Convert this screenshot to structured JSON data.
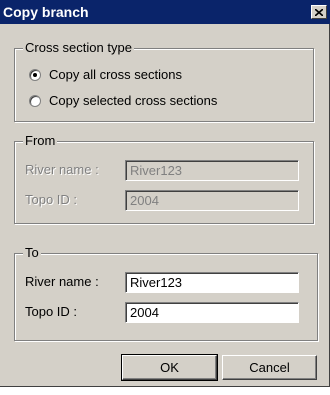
{
  "window": {
    "title": "Copy branch"
  },
  "cross_section": {
    "legend": "Cross section type",
    "options": [
      {
        "label": "Copy all cross sections",
        "selected": true
      },
      {
        "label": "Copy selected cross sections",
        "selected": false
      }
    ]
  },
  "from": {
    "legend": "From",
    "river_label": "River name :",
    "river_value": "River123",
    "topo_label": "Topo ID :",
    "topo_value": "2004"
  },
  "to": {
    "legend": "To",
    "river_label": "River name :",
    "river_value": "River123",
    "topo_label": "Topo ID :",
    "topo_value": "2004"
  },
  "buttons": {
    "ok": "OK",
    "cancel": "Cancel"
  },
  "colors": {
    "titlebar": "#0a246a",
    "face": "#d4d0c8"
  }
}
